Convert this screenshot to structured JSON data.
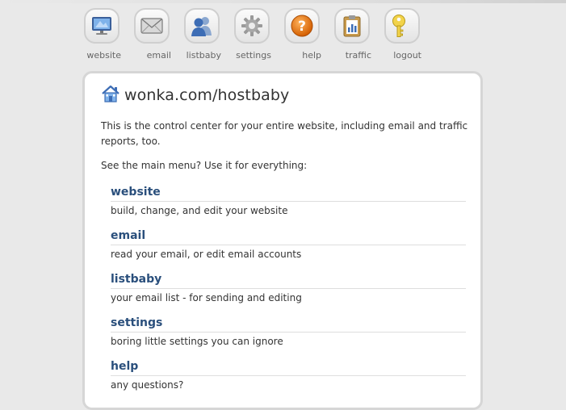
{
  "nav": {
    "items": [
      {
        "label": "website",
        "icon": "monitor-icon"
      },
      {
        "label": "email",
        "icon": "envelope-icon"
      },
      {
        "label": "listbaby",
        "icon": "people-icon"
      },
      {
        "label": "settings",
        "icon": "gear-icon"
      },
      {
        "label": "help",
        "icon": "question-icon"
      },
      {
        "label": "traffic",
        "icon": "clipboard-chart-icon"
      },
      {
        "label": "logout",
        "icon": "key-icon"
      }
    ]
  },
  "main": {
    "title": "wonka.com/hostbaby",
    "title_icon": "home-icon",
    "intro": "This is the control center for your entire website, including email and traffic reports, too.",
    "lead": "See the main menu? Use it for everything:",
    "menu": [
      {
        "label": "website",
        "desc": "build, change, and edit your website"
      },
      {
        "label": "email",
        "desc": "read your email, or edit email accounts"
      },
      {
        "label": "listbaby",
        "desc": "your email list - for sending and editing"
      },
      {
        "label": "settings",
        "desc": "boring little settings you can ignore"
      },
      {
        "label": "help",
        "desc": "any questions?"
      }
    ]
  },
  "colors": {
    "link": "#2a4f7c",
    "panel_border": "#d6d6d6",
    "background": "#e9e9e9"
  }
}
